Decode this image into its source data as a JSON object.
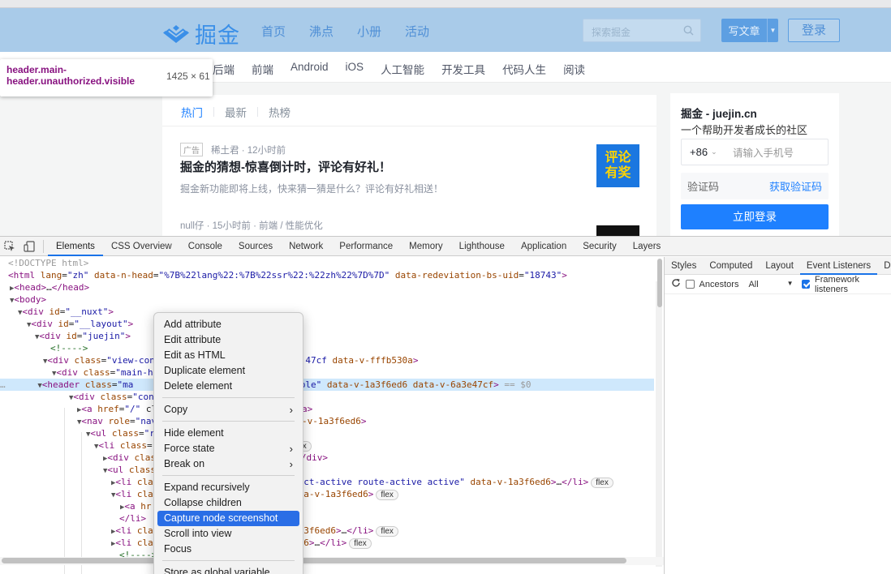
{
  "page": {
    "header": {
      "logo_text": "掘金",
      "nav": [
        "首页",
        "沸点",
        "小册",
        "活动"
      ],
      "search_placeholder": "探索掘金",
      "write_label": "写文章",
      "login_label": "登录"
    },
    "subnav": [
      "后端",
      "前端",
      "Android",
      "iOS",
      "人工智能",
      "开发工具",
      "代码人生",
      "阅读"
    ],
    "tooltip": {
      "selector": "header.main-header.unauthorized.visible",
      "size": "1425 × 61"
    },
    "feed": {
      "tabs": [
        "热门",
        "最新",
        "热榜"
      ],
      "ad": {
        "tag": "广告",
        "meta": "稀土君 · 12小时前",
        "title": "掘金的猜想-惊喜倒计时，评论有好礼！",
        "desc": "掘金新功能即将上线，快来猜一猜是什么？评论有好礼相送！",
        "thumb_text": "评论有奖"
      },
      "item2_meta": "null仔 · 15小时前 · 前端 / 性能优化"
    },
    "sidecard": {
      "title": "掘金 - juejin.cn",
      "subtitle": "一个帮助开发者成长的社区",
      "country_code": "+86",
      "phone_placeholder": "请输入手机号",
      "code_label": "验证码",
      "get_code": "获取验证码",
      "submit": "立即登录"
    }
  },
  "devtools": {
    "tabs": [
      "Elements",
      "CSS Overview",
      "Console",
      "Sources",
      "Network",
      "Performance",
      "Memory",
      "Lighthouse",
      "Application",
      "Security",
      "Layers"
    ],
    "styles_tabs": [
      "Styles",
      "Computed",
      "Layout",
      "Event Listeners",
      "DOM"
    ],
    "toolbar": {
      "ancestors": "Ancestors",
      "filter": "All",
      "framework": "Framework listeners"
    }
  },
  "context_menu": {
    "items": [
      "Add attribute",
      "Edit attribute",
      "Edit as HTML",
      "Duplicate element",
      "Delete element",
      "Copy",
      "Hide element",
      "Force state",
      "Break on",
      "Expand recursively",
      "Collapse children",
      "Capture node screenshot",
      "Scroll into view",
      "Focus",
      "Store as global variable"
    ],
    "highlighted": "Capture node screenshot"
  },
  "colors": {
    "header_bg": "#a9cbe9",
    "brand_blue": "#1e80ff",
    "selection": "#cfe8fc",
    "menu_highlight": "#2a6ee6"
  }
}
